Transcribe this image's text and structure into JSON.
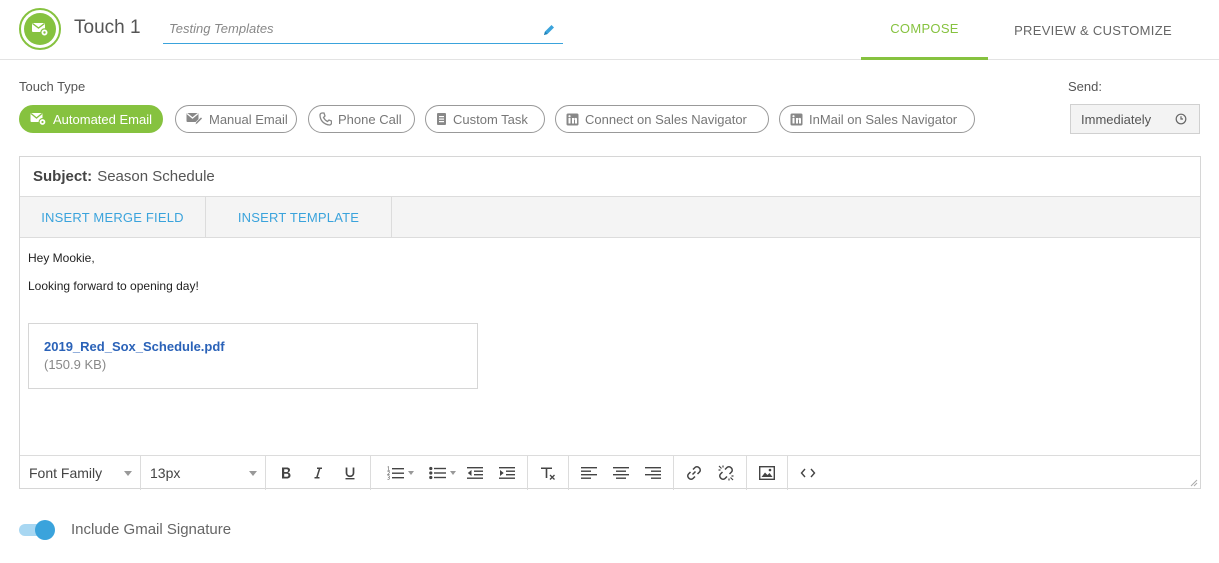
{
  "header": {
    "title": "Touch 1",
    "touch_name_value": "Testing Templates",
    "tabs": [
      {
        "label": "COMPOSE",
        "active": true
      },
      {
        "label": "PREVIEW & CUSTOMIZE",
        "active": false
      }
    ]
  },
  "touch_type": {
    "label": "Touch Type",
    "options": [
      {
        "label": "Automated Email",
        "icon": "automated-email-icon",
        "active": true
      },
      {
        "label": "Manual Email",
        "icon": "manual-email-icon",
        "active": false
      },
      {
        "label": "Phone Call",
        "icon": "phone-icon",
        "active": false
      },
      {
        "label": "Custom Task",
        "icon": "task-icon",
        "active": false
      },
      {
        "label": "Connect on Sales Navigator",
        "icon": "linkedin-icon",
        "active": false
      },
      {
        "label": "InMail on Sales Navigator",
        "icon": "linkedin-icon",
        "active": false
      }
    ]
  },
  "send": {
    "label": "Send:",
    "value": "Immediately"
  },
  "editor": {
    "subject_label": "Subject:",
    "subject_value": "Season Schedule",
    "insert_merge_label": "INSERT MERGE FIELD",
    "insert_template_label": "INSERT TEMPLATE",
    "body_lines": [
      "Hey Mookie,",
      "Looking forward to opening day!"
    ],
    "attachment": {
      "file_name": "2019_Red_Sox_Schedule.pdf",
      "file_size": "(150.9 KB)"
    },
    "toolbar": {
      "font_family": "Font Family",
      "font_size": "13px"
    }
  },
  "signature": {
    "label": "Include Gmail Signature",
    "enabled": true
  },
  "colors": {
    "accent_green": "#86c23f",
    "accent_blue": "#3aa3dc",
    "link_blue": "#2a62b8"
  }
}
